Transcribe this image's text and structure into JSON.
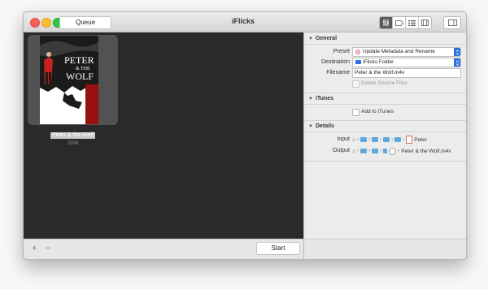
{
  "window": {
    "title": "iFlicks",
    "queue_button": "Queue"
  },
  "queue": {
    "items": [
      {
        "title": "Peter & the Wolf",
        "year": "2006",
        "poster_text": "PETER & THE WOLF"
      }
    ],
    "start_button": "Start",
    "add_symbol": "+",
    "remove_symbol": "−"
  },
  "general": {
    "header": "General",
    "preset_label": "Preset",
    "preset_value": "Update Metadata and Rename",
    "destination_label": "Destination",
    "destination_value": "iFlicks Folder",
    "filename_label": "Filename",
    "filename_value": "Peter & the Wolf.m4v",
    "delete_source_label": "Delete Source Files"
  },
  "itunes": {
    "header": "iTunes",
    "add_label": "Add to iTunes"
  },
  "details": {
    "header": "Details",
    "input_label": "Input",
    "input_file": "Peter",
    "output_label": "Output",
    "output_file": "Peter & the Wolf.m4v"
  },
  "colors": {
    "accent": "#2b6fe0",
    "folder": "#5fa8de",
    "queue_bg": "#2a2a2a"
  }
}
